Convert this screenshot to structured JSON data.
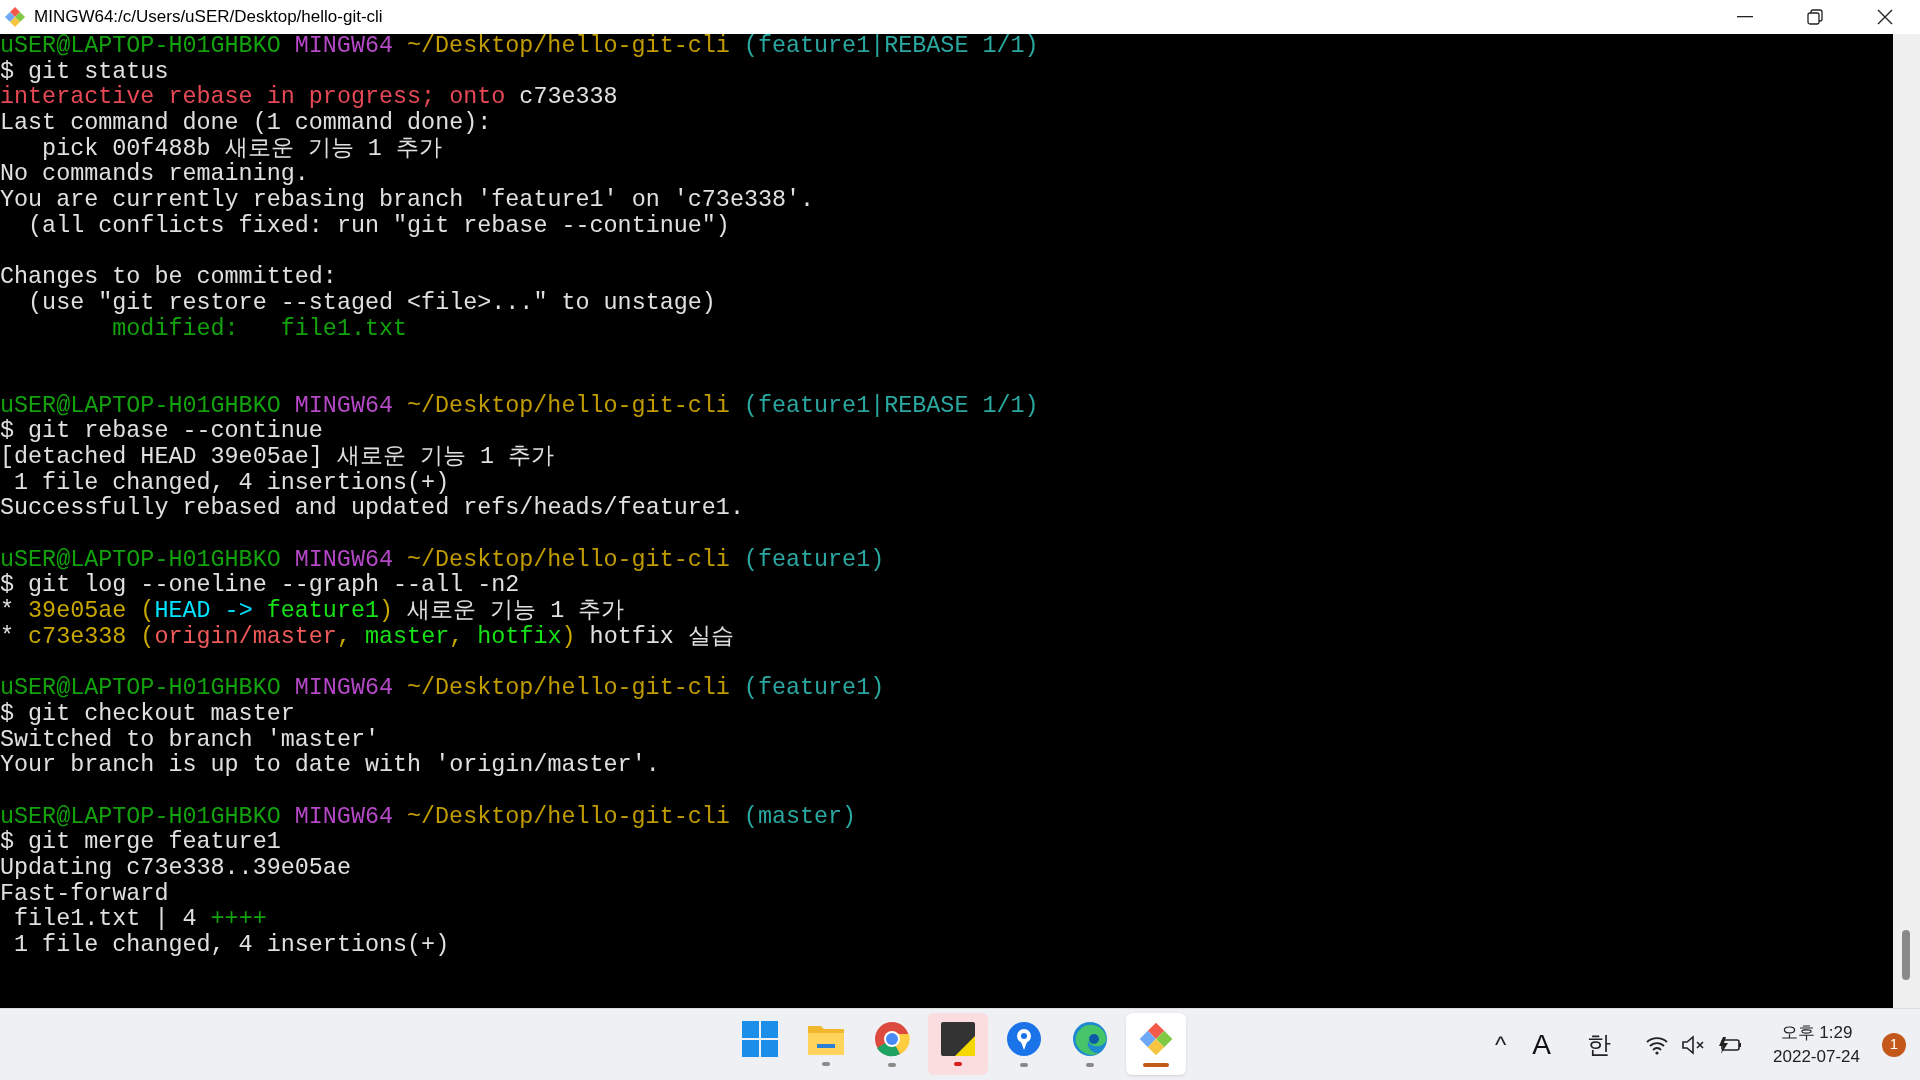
{
  "window": {
    "title": "MINGW64:/c/Users/uSER/Desktop/hello-git-cli"
  },
  "terminal": {
    "lines": [
      {
        "kind": "prompt",
        "user": "uSER@LAPTOP-H01GHBKO",
        "shell": "MINGW64",
        "path": "~/Desktop/hello-git-cli",
        "branch": "(feature1|REBASE 1/1)"
      },
      {
        "kind": "text",
        "segments": [
          {
            "text": "$ git status",
            "color": "#e0e0e0"
          }
        ]
      },
      {
        "kind": "text",
        "segments": [
          {
            "text": "interactive rebase in progress; onto ",
            "color": "#e74856"
          },
          {
            "text": "c73e338",
            "color": "#e0e0e0"
          }
        ]
      },
      {
        "kind": "text",
        "segments": [
          {
            "text": "Last command done (1 command done):",
            "color": "#e0e0e0"
          }
        ]
      },
      {
        "kind": "text",
        "segments": [
          {
            "text": "   pick 00f488b 새로운 기능 1 추가",
            "color": "#e0e0e0"
          }
        ]
      },
      {
        "kind": "text",
        "segments": [
          {
            "text": "No commands remaining.",
            "color": "#e0e0e0"
          }
        ]
      },
      {
        "kind": "text",
        "segments": [
          {
            "text": "You are currently rebasing branch 'feature1' on 'c73e338'.",
            "color": "#e0e0e0"
          }
        ]
      },
      {
        "kind": "text",
        "segments": [
          {
            "text": "  (all conflicts fixed: run \"git rebase --continue\")",
            "color": "#e0e0e0"
          }
        ]
      },
      {
        "kind": "blank"
      },
      {
        "kind": "text",
        "segments": [
          {
            "text": "Changes to be committed:",
            "color": "#e0e0e0"
          }
        ]
      },
      {
        "kind": "text",
        "segments": [
          {
            "text": "  (use \"git restore --staged <file>...\" to unstage)",
            "color": "#e0e0e0"
          }
        ]
      },
      {
        "kind": "text",
        "segments": [
          {
            "text": "        modified:   file1.txt",
            "color": "#13a10e"
          }
        ]
      },
      {
        "kind": "blank"
      },
      {
        "kind": "blank"
      },
      {
        "kind": "prompt",
        "user": "uSER@LAPTOP-H01GHBKO",
        "shell": "MINGW64",
        "path": "~/Desktop/hello-git-cli",
        "branch": "(feature1|REBASE 1/1)"
      },
      {
        "kind": "text",
        "segments": [
          {
            "text": "$ git rebase --continue",
            "color": "#e0e0e0"
          }
        ]
      },
      {
        "kind": "text",
        "segments": [
          {
            "text": "[detached HEAD 39e05ae] 새로운 기능 1 추가",
            "color": "#e0e0e0"
          }
        ]
      },
      {
        "kind": "text",
        "segments": [
          {
            "text": " 1 file changed, 4 insertions(+)",
            "color": "#e0e0e0"
          }
        ]
      },
      {
        "kind": "text",
        "segments": [
          {
            "text": "Successfully rebased and updated refs/heads/feature1.",
            "color": "#e0e0e0"
          }
        ]
      },
      {
        "kind": "blank"
      },
      {
        "kind": "prompt",
        "user": "uSER@LAPTOP-H01GHBKO",
        "shell": "MINGW64",
        "path": "~/Desktop/hello-git-cli",
        "branch": "(feature1)"
      },
      {
        "kind": "text",
        "segments": [
          {
            "text": "$ git log --oneline --graph --all -n2",
            "color": "#e0e0e0"
          }
        ]
      },
      {
        "kind": "text",
        "segments": [
          {
            "text": "* ",
            "color": "#e0e0e0"
          },
          {
            "text": "39e05ae (",
            "color": "#c8a800"
          },
          {
            "text": "HEAD -> ",
            "color": "#00e5ff"
          },
          {
            "text": "feature1",
            "color": "#16e016"
          },
          {
            "text": ")",
            "color": "#c8a800"
          },
          {
            "text": " 새로운 기능 1 추가",
            "color": "#e0e0e0"
          }
        ]
      },
      {
        "kind": "text",
        "segments": [
          {
            "text": "* ",
            "color": "#e0e0e0"
          },
          {
            "text": "c73e338 (",
            "color": "#c8a800"
          },
          {
            "text": "origin/master",
            "color": "#f05a5a"
          },
          {
            "text": ", ",
            "color": "#c8a800"
          },
          {
            "text": "master",
            "color": "#16e016"
          },
          {
            "text": ", ",
            "color": "#c8a800"
          },
          {
            "text": "hotfix",
            "color": "#16e016"
          },
          {
            "text": ")",
            "color": "#c8a800"
          },
          {
            "text": " hotfix 실습",
            "color": "#e0e0e0"
          }
        ]
      },
      {
        "kind": "blank"
      },
      {
        "kind": "prompt",
        "user": "uSER@LAPTOP-H01GHBKO",
        "shell": "MINGW64",
        "path": "~/Desktop/hello-git-cli",
        "branch": "(feature1)"
      },
      {
        "kind": "text",
        "segments": [
          {
            "text": "$ git checkout master",
            "color": "#e0e0e0"
          }
        ]
      },
      {
        "kind": "text",
        "segments": [
          {
            "text": "Switched to branch 'master'",
            "color": "#e0e0e0"
          }
        ]
      },
      {
        "kind": "text",
        "segments": [
          {
            "text": "Your branch is up to date with 'origin/master'.",
            "color": "#e0e0e0"
          }
        ]
      },
      {
        "kind": "blank"
      },
      {
        "kind": "prompt",
        "user": "uSER@LAPTOP-H01GHBKO",
        "shell": "MINGW64",
        "path": "~/Desktop/hello-git-cli",
        "branch": "(master)"
      },
      {
        "kind": "text",
        "segments": [
          {
            "text": "$ git merge feature1",
            "color": "#e0e0e0"
          }
        ]
      },
      {
        "kind": "text",
        "segments": [
          {
            "text": "Updating c73e338..39e05ae",
            "color": "#e0e0e0"
          }
        ]
      },
      {
        "kind": "text",
        "segments": [
          {
            "text": "Fast-forward",
            "color": "#e0e0e0"
          }
        ]
      },
      {
        "kind": "text",
        "segments": [
          {
            "text": " file1.txt | 4 ",
            "color": "#e0e0e0"
          },
          {
            "text": "++++",
            "color": "#13a10e"
          }
        ]
      },
      {
        "kind": "text",
        "segments": [
          {
            "text": " 1 file changed, 4 insertions(+)",
            "color": "#e0e0e0"
          }
        ]
      }
    ]
  },
  "taskbar": {
    "apps": [
      {
        "kind": "start",
        "running": false,
        "active": false,
        "flashing": false
      },
      {
        "kind": "folder",
        "running": true,
        "active": false,
        "flashing": false
      },
      {
        "kind": "browser",
        "running": true,
        "active": false,
        "flashing": false
      },
      {
        "kind": "note",
        "running": true,
        "active": false,
        "flashing": true
      },
      {
        "kind": "pin",
        "running": true,
        "active": false,
        "flashing": false
      },
      {
        "kind": "edge",
        "running": true,
        "active": false,
        "flashing": false
      },
      {
        "kind": "git",
        "running": true,
        "active": true,
        "flashing": false
      }
    ],
    "tray": {
      "chevron": "^",
      "input_mode": "A",
      "language": "한",
      "time": "오후 1:29",
      "date": "2022-07-24",
      "notifications": "1"
    }
  }
}
